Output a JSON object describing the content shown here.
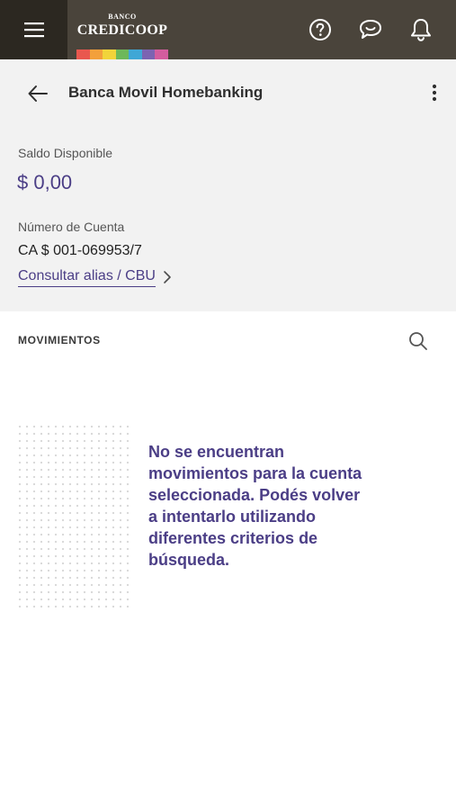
{
  "topbar": {
    "brand_small": "BANCO",
    "brand_name": "CREDICOOP",
    "brand_colors": [
      "#e9574e",
      "#f3a03b",
      "#f1d43a",
      "#6db85a",
      "#3fa7d6",
      "#7c63b2",
      "#d35d9e"
    ],
    "icons": [
      "menu-icon",
      "help-icon",
      "chat-icon",
      "bell-icon"
    ]
  },
  "header": {
    "title": "Banca Movil Homebanking"
  },
  "account": {
    "balance_label": "Saldo Disponible",
    "balance_value": "$ 0,00",
    "number_label": "Número de Cuenta",
    "number_value": "CA $ 001-069953/7",
    "alias_link": "Consultar alias / CBU"
  },
  "movements": {
    "section_title": "MOVIMIENTOS",
    "empty_message": "No se encuentran movimientos para la cuenta seleccionada. Podés volver a intentarlo utilizando diferentes criterios de búsqueda."
  },
  "colors": {
    "topbar": "#4a443b",
    "accent": "#4b3e86",
    "card_bg": "#f2f2f2"
  }
}
